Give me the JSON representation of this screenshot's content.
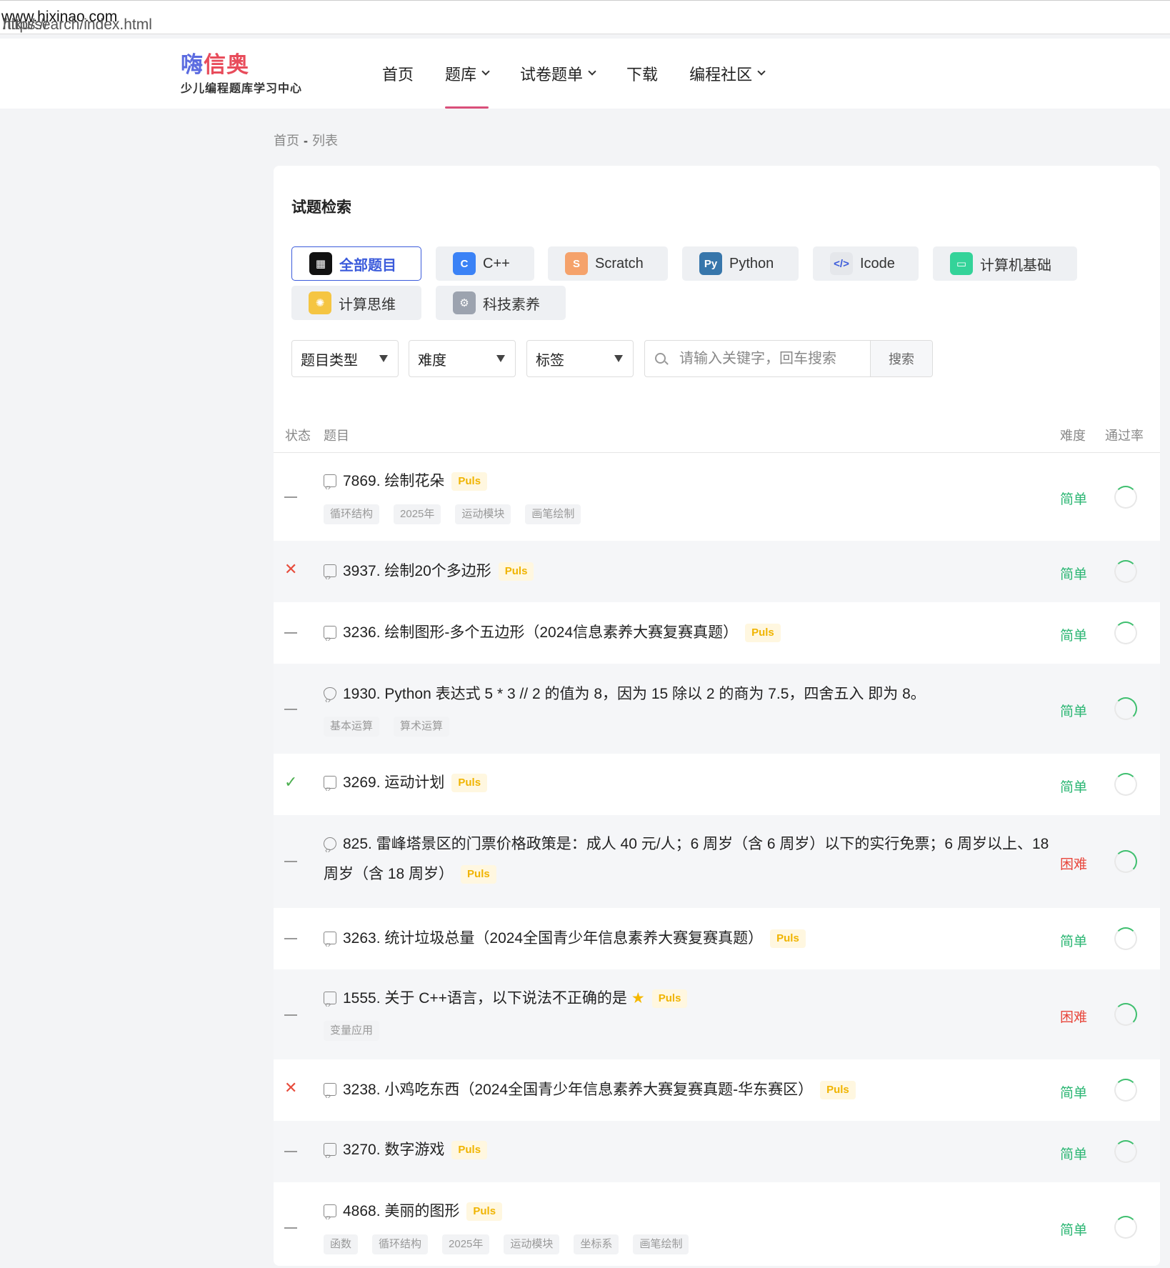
{
  "browser": {
    "url_prefix": "https://",
    "url_host": "www.hixinao.com",
    "url_path": "/tiku/search/index.html"
  },
  "logo": {
    "brand_a": "嗨",
    "brand_b": "信奥",
    "subtitle": "少儿编程题库学习中心"
  },
  "nav": [
    {
      "label": "首页"
    },
    {
      "label": "题库"
    },
    {
      "label": "试卷题单"
    },
    {
      "label": "下载"
    },
    {
      "label": "编程社区"
    }
  ],
  "breadcrumb": {
    "home": "首页",
    "sep": "-",
    "current": "列表"
  },
  "panel": {
    "title": "试题检索"
  },
  "categories": [
    {
      "label": "全部题目",
      "icon": "grid-icon",
      "color": "#111111"
    },
    {
      "label": "C++",
      "icon": "cpp-icon",
      "color": "#3b82f6"
    },
    {
      "label": "Scratch",
      "icon": "scratch-icon",
      "color": "#f59e5b"
    },
    {
      "label": "Python",
      "icon": "python-icon",
      "color": "#3776ab"
    },
    {
      "label": "Icode",
      "icon": "code-icon",
      "color": "#e5e7eb"
    },
    {
      "label": "计算机基础",
      "icon": "chat-icon",
      "color": "#34d399"
    },
    {
      "label": "计算思维",
      "icon": "bulb-icon",
      "color": "#f5c542"
    },
    {
      "label": "科技素养",
      "icon": "tech-icon",
      "color": "#9ca3af"
    }
  ],
  "filters": {
    "type": "题目类型",
    "difficulty": "难度",
    "tags": "标签",
    "search_placeholder": "请输入关键字，回车搜索",
    "search_button": "搜索"
  },
  "table_headers": {
    "status": "状态",
    "title": "题目",
    "difficulty": "难度",
    "pass_rate": "通过率"
  },
  "plus_label": "Puls",
  "rows": [
    {
      "status": "—",
      "title": "7869. 绘制花朵",
      "tags": [
        "循环结构",
        "2025年",
        "运动模块",
        "画笔绘制"
      ],
      "difficulty": "简单"
    },
    {
      "status": "✕",
      "title": "3937. 绘制20个多边形",
      "difficulty": "简单"
    },
    {
      "status": "—",
      "title": "3236. 绘制图形-多个五边形（2024信息素养大赛复赛真题）",
      "difficulty": "简单"
    },
    {
      "status": "—",
      "title": "1930. Python 表达式 5 * 3 // 2 的值为 8，因为 15 除以 2 的商为 7.5，四舍五入 即为 8。",
      "tags": [
        "基本运算",
        "算术运算"
      ],
      "difficulty": "简单"
    },
    {
      "status": "✓",
      "title": "3269. 运动计划",
      "difficulty": "简单"
    },
    {
      "status": "—",
      "title": "825. 雷峰塔景区的门票价格政策是：成人 40 元/人；6 周岁（含 6 周岁）以下的实行免票；6 周岁以上、18 周岁（含 18 周岁）",
      "difficulty": "困难"
    },
    {
      "status": "—",
      "title": "3263. 统计垃圾总量（2024全国青少年信息素养大赛复赛真题）",
      "difficulty": "简单"
    },
    {
      "status": "—",
      "title": "1555. 关于 C++语言，以下说法不正确的是",
      "tags": [
        "变量应用"
      ],
      "difficulty": "困难"
    },
    {
      "status": "✕",
      "title": "3238. 小鸡吃东西（2024全国青少年信息素养大赛复赛真题-华东赛区）",
      "difficulty": "简单"
    },
    {
      "status": "—",
      "title": "3270. 数字游戏",
      "difficulty": "简单"
    },
    {
      "status": "—",
      "title": "4868. 美丽的图形",
      "tags": [
        "函数",
        "循环结构",
        "2025年",
        "运动模块",
        "坐标系",
        "画笔绘制"
      ],
      "difficulty": "简单"
    }
  ]
}
